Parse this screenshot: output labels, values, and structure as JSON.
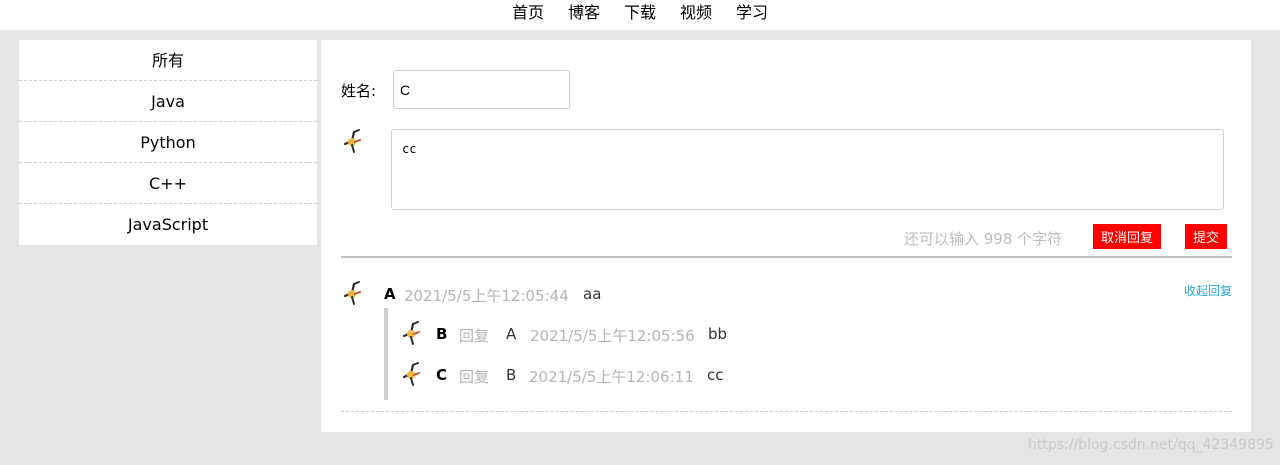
{
  "nav": {
    "items": [
      "首页",
      "博客",
      "下载",
      "视频",
      "学习"
    ]
  },
  "sidebar": {
    "items": [
      "所有",
      "Java",
      "Python",
      "C++",
      "JavaScript"
    ]
  },
  "form": {
    "name_label": "姓名:",
    "name_value": "C",
    "comment_value": "cc",
    "counter_text": "还可以输入 998 个字符",
    "cancel_label": "取消回复",
    "submit_label": "提交"
  },
  "comment": {
    "author": "A",
    "time": "2021/5/5上午12:05:44",
    "text": "aa",
    "collapse_label": "收起回复"
  },
  "replies": [
    {
      "author": "B",
      "reply_word": "回复",
      "to": "A",
      "time": "2021/5/5上午12:05:56",
      "text": "bb"
    },
    {
      "author": "C",
      "reply_word": "回复",
      "to": "B",
      "time": "2021/5/5上午12:06:11",
      "text": "cc"
    }
  ],
  "watermark": "https://blog.csdn.net/qq_42349895",
  "colors": {
    "accent_button": "#ff0000",
    "link": "#2aa7d6",
    "muted": "#b5b5b5"
  },
  "icons": {
    "avatar": "avatar-icon"
  }
}
